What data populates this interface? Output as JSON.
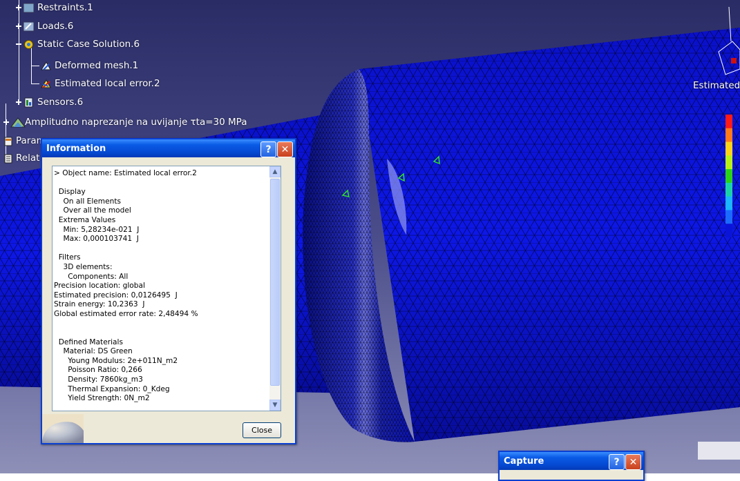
{
  "tree": {
    "items": [
      {
        "label": "Restraints.1"
      },
      {
        "label": "Loads.6"
      },
      {
        "label": "Static Case Solution.6"
      },
      {
        "label": "Deformed mesh.1"
      },
      {
        "label": "Estimated local error.2"
      },
      {
        "label": "Sensors.6"
      },
      {
        "label": "Amplitudno naprezanje na uvijanje τta=30 MPa"
      },
      {
        "label": "Param"
      },
      {
        "label": "Relat"
      }
    ]
  },
  "viewport": {
    "estimated_label": "Estimated",
    "colorbar_colors": [
      "#ff1a1a",
      "#ff7a1a",
      "#ffd21a",
      "#b8f01a",
      "#2ad21a",
      "#1ad2a8",
      "#1ab4ff",
      "#1a6aff",
      "#0a14d8"
    ]
  },
  "info_dialog": {
    "title": "Information",
    "help_label": "?",
    "close_x_label": "✕",
    "close_button": "Close",
    "lines": [
      "> Object name: Estimated local error.2",
      "",
      "  Display",
      "    On all Elements",
      "    Over all the model",
      "  Extrema Values",
      "    Min: 5,28234e-021  J",
      "    Max: 0,000103741  J",
      "",
      "  Filters",
      "    3D elements:",
      "      Components: All",
      "Precision location: global",
      "Estimated precision: 0,0126495  J",
      "Strain energy: 10,2363  J",
      "Global estimated error rate: 2,48494 %",
      "",
      "",
      "  Defined Materials",
      "    Material: DS Green",
      "      Young Modulus: 2e+011N_m2",
      "      Poisson Ratio: 0,266",
      "      Density: 7860kg_m3",
      "      Thermal Expansion: 0_Kdeg",
      "      Yield Strength: 0N_m2"
    ]
  },
  "capture_dialog": {
    "title": "Capture",
    "help_label": "?",
    "close_x_label": "✕"
  }
}
